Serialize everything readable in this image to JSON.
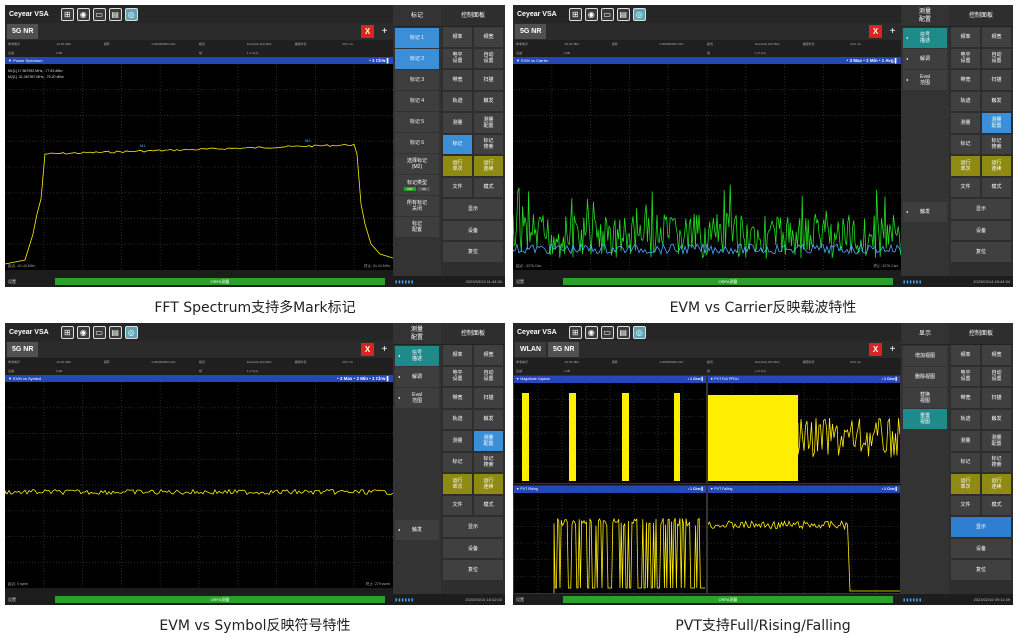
{
  "app_title": "Ceyear VSA",
  "captions": [
    "FFT Spectrum支持多Mark标记",
    "EVM vs Carrier反映载波特性",
    "EVM vs Symbol反映符号特性",
    "PVT支持Full/Rising/Falling"
  ],
  "panels": [
    {
      "tabs": [
        "5G NR"
      ],
      "banner": "▼ Power Spectrum",
      "banner_right": "• 1 Clrw ▌",
      "marker_lines": [
        "M1[1]    17.867952 MHz, -77.63 dBm",
        "M2[1]   -31.067957 MHz, -75.20 dBm"
      ],
      "footer_left": "起点: -61.44 MHz",
      "footer_right": "终止: 61.44 MHz",
      "status_left": "设置",
      "status_mid": "ORFA测量",
      "time": "2023/03/13 11:44:34",
      "menu_title": "标记",
      "menu": [
        "标记 1",
        "标记 2",
        "标记 3",
        "标记 4",
        "标记 5",
        "标记 6",
        "选择标记\n(M2)",
        "标记类型",
        "所有标记\n关闭",
        "标记\n配置"
      ],
      "toggle": [
        "OFF",
        "ON"
      ],
      "ctrl": [
        "频率",
        "频宽",
        "电平\n设置",
        "自动\n设置",
        "带宽",
        "扫描",
        "轨迹",
        "触发",
        "测量",
        "测量\n配置",
        "标记",
        "标记\n搜索",
        "运行\n单次",
        "运行\n连续",
        "文件",
        "模式",
        "显示",
        "设备",
        "复位"
      ]
    },
    {
      "tabs": [
        "5G NR"
      ],
      "banner": "▼ EVM vs Carrier",
      "banner_right": "• 3 Max • 2 Min • 1 Avg ▌",
      "footer_left": "起点: -3276 Carr",
      "footer_right": "终止: 3276 Carr",
      "status_left": "设置",
      "status_mid": "ORFA测量",
      "time": "2023/03/14 18:44:34",
      "menu_title": "测量\n配置",
      "menu": [
        "信号\n描述",
        "解调",
        "Eval\n范围",
        "触发"
      ],
      "ctrl": [
        "频率",
        "频宽",
        "电平\n设置",
        "自动\n设置",
        "带宽",
        "扫描",
        "轨迹",
        "触发",
        "测量",
        "测量\n配置",
        "标记",
        "标记\n搜索",
        "运行\n单次",
        "运行\n连续",
        "文件",
        "模式",
        "显示",
        "设备",
        "复位"
      ]
    },
    {
      "tabs": [
        "5G NR"
      ],
      "banner": "▼ EVM vs Symbol",
      "banner_right": "• 3 Max • 2 Min • 1 Clrw ▌",
      "footer_left": "起点: 0 symb",
      "footer_right": "终止: 279 symb",
      "status_left": "设置",
      "status_mid": "ORFA测量",
      "time": "2023/03/14 18:42:03",
      "menu_title": "测量\n配置",
      "menu": [
        "信号\n描述",
        "解调",
        "Eval\n范围",
        "触发"
      ],
      "ctrl": [
        "频率",
        "频宽",
        "电平\n设置",
        "自动\n设置",
        "带宽",
        "扫描",
        "轨迹",
        "触发",
        "测量",
        "测量\n配置",
        "标记",
        "标记\n搜索",
        "运行\n单次",
        "运行\n连续",
        "文件",
        "模式",
        "显示",
        "设备",
        "复位"
      ]
    },
    {
      "tabs": [
        "WLAN",
        "5G NR"
      ],
      "quads": [
        {
          "banner": "▼ Magnitude Capture",
          "right": "• 1 Clrw ▌"
        },
        {
          "banner": "▼ PVT Full PPDU",
          "right": "• 1 Clrw ▌"
        },
        {
          "banner": "▼ PVT Rising",
          "right": "• 1 Clrw ▌"
        },
        {
          "banner": "▼ PVT Falling",
          "right": "• 1 Clrw ▌"
        }
      ],
      "status_left": "设置",
      "status_mid": "ORFA测量",
      "time": "2023/02/16 09:11:49",
      "menu_title": "显示",
      "menu": [
        "增加视图",
        "删除视图",
        "替换\n视图",
        "重置\n视图"
      ],
      "ctrl": [
        "频率",
        "频宽",
        "电平\n设置",
        "自动\n设置",
        "带宽",
        "扫描",
        "轨迹",
        "触发",
        "测量",
        "测量\n配置",
        "标记",
        "标记\n搜索",
        "运行\n单次",
        "运行\n连续",
        "文件",
        "模式",
        "显示",
        "设备",
        "复位"
      ]
    }
  ],
  "control_title": "控制面板",
  "params": [
    "参考电平",
    "-10.00 dBm",
    "频率",
    "1.000000000 GHz",
    "模式",
    "Downlink,100 MHz",
    "捕获时长",
    "20.0 ms",
    "衰减",
    "0 dB",
    "",
    "",
    "帧",
    "1 of 1(1)",
    "",
    ""
  ]
}
